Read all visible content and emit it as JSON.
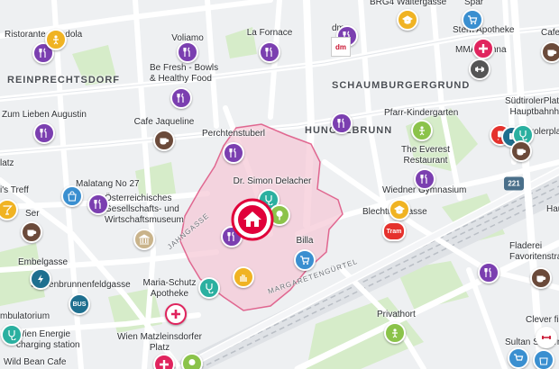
{
  "districts": [
    {
      "id": "reinprechtsdorf",
      "text": "REINPRECHTSDORF"
    },
    {
      "id": "schaumburgergrund",
      "text": "SCHAUMBURGERGRUND"
    },
    {
      "id": "hungelbrunn",
      "text": "HUNGELBRUNN"
    }
  ],
  "streets": [
    {
      "id": "jahngasse",
      "text": "JAHNGASSE"
    },
    {
      "id": "margaretenguertel",
      "text": "MARGARETENGÜRTEL"
    }
  ],
  "road_shield": "221",
  "brand_dm": "dm",
  "bus_label": "BUS",
  "tram_label": "Tram",
  "labels": [
    {
      "id": "ristorante-gondola",
      "text": "Ristorante Gondola"
    },
    {
      "id": "voliamo",
      "text": "Voliamo"
    },
    {
      "id": "la-fornace",
      "text": "La Fornace"
    },
    {
      "id": "dm",
      "text": "dm"
    },
    {
      "id": "brg4",
      "text": "BRG4 Waltergasse"
    },
    {
      "id": "spar",
      "text": "Spar"
    },
    {
      "id": "sterne-apotheke",
      "text": "Stern Apotheke"
    },
    {
      "id": "cafe-top",
      "text": "Cafe"
    },
    {
      "id": "mma-vienna",
      "text": "MMA Vienna"
    },
    {
      "id": "be-fresh",
      "text": "Be Fresh - Bowls\n& Healthy Food"
    },
    {
      "id": "zum-lieben-augustin",
      "text": "Zum Lieben Augustin"
    },
    {
      "id": "cafe-jaqueline",
      "text": "Cafe Jaqueline"
    },
    {
      "id": "pfarr-kindergarten",
      "text": "Pfarr-Kindergarten"
    },
    {
      "id": "suedtiroler-platz",
      "text": "SüdtirolerPlatz-\nHauptbahnhof"
    },
    {
      "id": "perchtenstuberl",
      "text": "Perchtenstuberl"
    },
    {
      "id": "suedtirolerplatz2",
      "text": "Südtirolerplatz"
    },
    {
      "id": "the-everest",
      "text": "The Everest\nRestaurant"
    },
    {
      "id": "platz-left",
      "text": "latz"
    },
    {
      "id": "malatang",
      "text": "Malatang No 27"
    },
    {
      "id": "dr-delacher",
      "text": "Dr. Simon Delacher"
    },
    {
      "id": "wiedner-gymnasium",
      "text": "Wiedner Gymnasium"
    },
    {
      "id": "treff",
      "text": "i's Treff"
    },
    {
      "id": "oesterr-museum",
      "text": "Österreichisches\nGesellschafts- und\nWirtschaftsmuseum"
    },
    {
      "id": "blechturmgasse",
      "text": "Blechturmgasse"
    },
    {
      "id": "ser",
      "text": "Ser"
    },
    {
      "id": "hau",
      "text": "Hau"
    },
    {
      "id": "billa",
      "text": "Billa"
    },
    {
      "id": "fladerei",
      "text": "Fladerei\nFavoritenstra"
    },
    {
      "id": "embelgasse",
      "text": "Embelgasse"
    },
    {
      "id": "siebenbrunnenfeldgasse",
      "text": "Siebenbrunnenfeldgasse"
    },
    {
      "id": "maria-schutz",
      "text": "Maria-Schutz\nApotheke"
    },
    {
      "id": "ambulatorium",
      "text": "mbulatorium"
    },
    {
      "id": "privathort",
      "text": "Privathort"
    },
    {
      "id": "clever-fit",
      "text": "Clever fi"
    },
    {
      "id": "wien-energie",
      "text": "Wien Energie\ncharging station"
    },
    {
      "id": "wien-matzleinsdorfer",
      "text": "Wien Matzleinsdorfer\nPlatz"
    },
    {
      "id": "sultan-supermarket",
      "text": "Sultan Superma"
    },
    {
      "id": "wild-bean-cafe",
      "text": "Wild Bean Cafe"
    }
  ],
  "colors": {
    "restaurant": "#7b3fb0",
    "cafe": "#6b4a3a",
    "shop": "#3a8fd0",
    "health": "#e0245e",
    "education": "#f0b323",
    "transport": "#1e6f8f",
    "leisure": "#8bc34a",
    "medical": "#2bb0a0",
    "area_fill": "#f5c8d6",
    "area_stroke": "#d9336b",
    "home": "#e0003a",
    "museum": "#c9b38a",
    "fitness": "#555555",
    "tram": "#e5322d"
  }
}
